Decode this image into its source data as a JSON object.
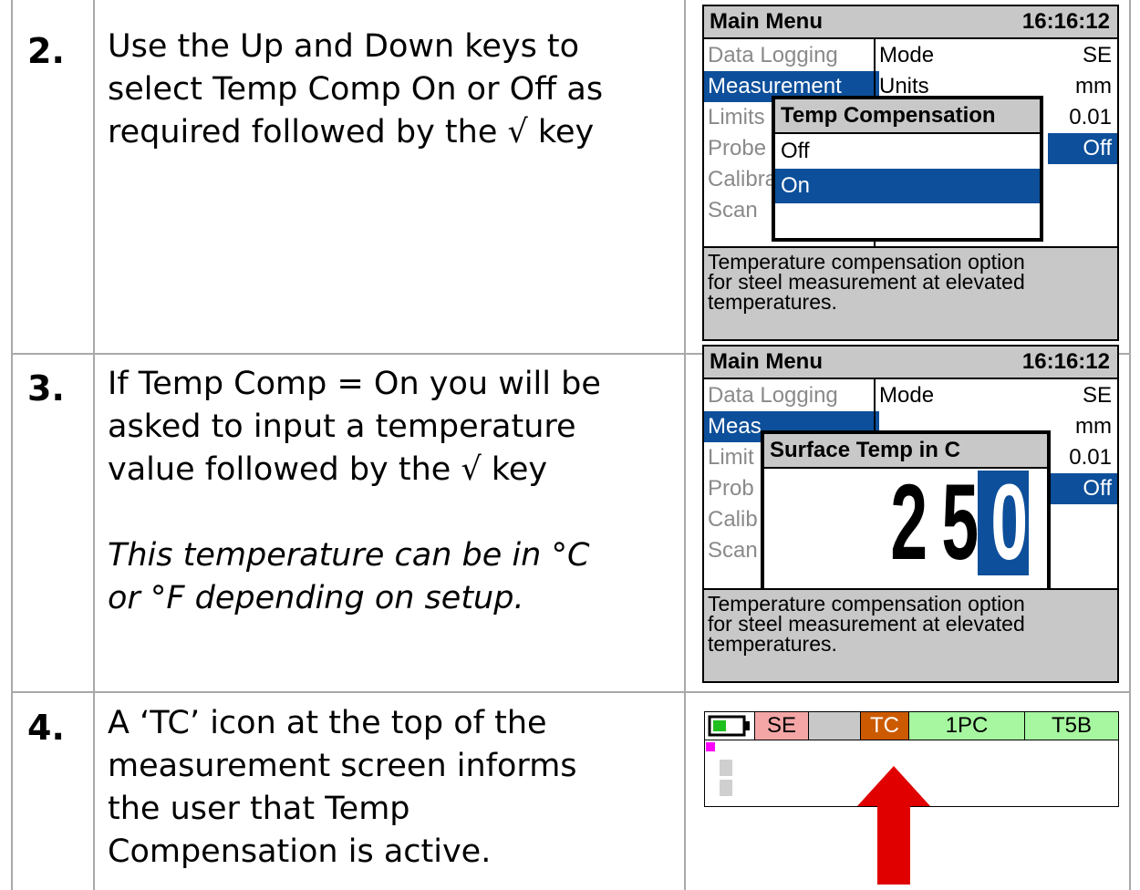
{
  "steps": [
    {
      "number": "2.",
      "lines": [
        "Use the Up and Down keys to",
        "select Temp Comp On or Off as",
        "required followed by the √ key"
      ],
      "screen": {
        "title": "Main Menu",
        "clock": "16:16:12",
        "menu": [
          "Data Logging",
          "Measurement",
          "Limits",
          "Probe",
          "Calibra",
          "Scan"
        ],
        "params": [
          {
            "label": "Mode",
            "value": "SE"
          },
          {
            "label": "Units",
            "value": "mm"
          },
          {
            "label": "",
            "value": "0.01"
          },
          {
            "label": "",
            "value": "Off"
          }
        ],
        "popup_title": "Temp Compensation",
        "popup_options": [
          "Off",
          "On"
        ],
        "footer": [
          "Temperature compensation option",
          "for steel measurement at elevated",
          "temperatures."
        ]
      }
    },
    {
      "number": "3.",
      "lines": [
        "If Temp Comp = On you will be",
        "asked to input a temperature",
        "value followed by the √ key"
      ],
      "italic_lines": [
        "This temperature can be in °C",
        "or °F depending on setup."
      ],
      "screen": {
        "title": "Main Menu",
        "clock": "16:16:12",
        "menu": [
          "Data Logging",
          "Meas",
          "Limit",
          "Prob",
          "Calib",
          "Scan"
        ],
        "params": [
          {
            "label": "Mode",
            "value": "SE"
          },
          {
            "label": "",
            "value": "mm"
          },
          {
            "label": "",
            "value": "0.01"
          },
          {
            "label": "",
            "value": "Off"
          }
        ],
        "popup_title": "Surface Temp in C",
        "digits": [
          "2",
          "5",
          "0"
        ],
        "footer": [
          "Temperature compensation option",
          "for steel measurement at elevated",
          "temperatures."
        ]
      }
    },
    {
      "number": "4.",
      "lines": [
        "A ‘TC’ icon at the top of the",
        "measurement screen informs",
        "the user that Temp",
        "Compensation is active."
      ],
      "status_bar": {
        "mode": "SE",
        "tc": "TC",
        "pc": "1PC",
        "probe": "T5B"
      }
    }
  ],
  "colors": {
    "selection": "#0d4f9a",
    "tc_badge": "#cc5a00",
    "se_badge": "#f4a6a6",
    "green_badge": "#a6f7a0",
    "arrow": "#e00000",
    "battery": "#1fbf1f"
  },
  "icons": [
    "battery-icon",
    "up-arrow-icon"
  ]
}
